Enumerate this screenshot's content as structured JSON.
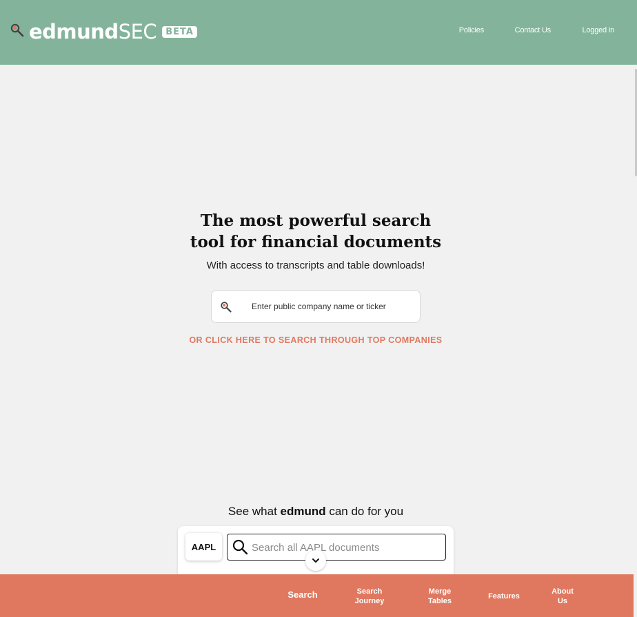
{
  "header": {
    "logo_bold": "edmund",
    "logo_light": "SEC",
    "beta_badge": "BETA",
    "nav": [
      {
        "label": "Policies"
      },
      {
        "label": "Contact Us"
      },
      {
        "label": "Logged in"
      }
    ]
  },
  "hero": {
    "title_line1": "The most powerful search",
    "title_line2": "tool for financial documents",
    "subtitle": "With access to transcripts and table downloads!",
    "search_placeholder": "Enter public company name or ticker",
    "top_companies_link": "OR CLICK HERE TO SEARCH THROUGH TOP COMPANIES"
  },
  "demo": {
    "heading_pre": "See what ",
    "heading_bold": "edmund",
    "heading_post": " can do for you",
    "ticker": "AAPL",
    "search_placeholder": "Search all AAPL documents"
  },
  "footer": {
    "search": "Search",
    "search_journey_1": "Search",
    "search_journey_2": "Journey",
    "merge_tables_1": "Merge",
    "merge_tables_2": "Tables",
    "features": "Features",
    "about_us_1": "About",
    "about_us_2": "Us"
  },
  "colors": {
    "header_bg": "#83b49b",
    "accent": "#e0785f",
    "page_bg": "#f1f1f1"
  },
  "icons": {
    "logo": "search-wand-icon",
    "hero_search": "search-wand-icon",
    "demo_search": "magnifier-icon",
    "expand": "chevron-down-icon"
  }
}
